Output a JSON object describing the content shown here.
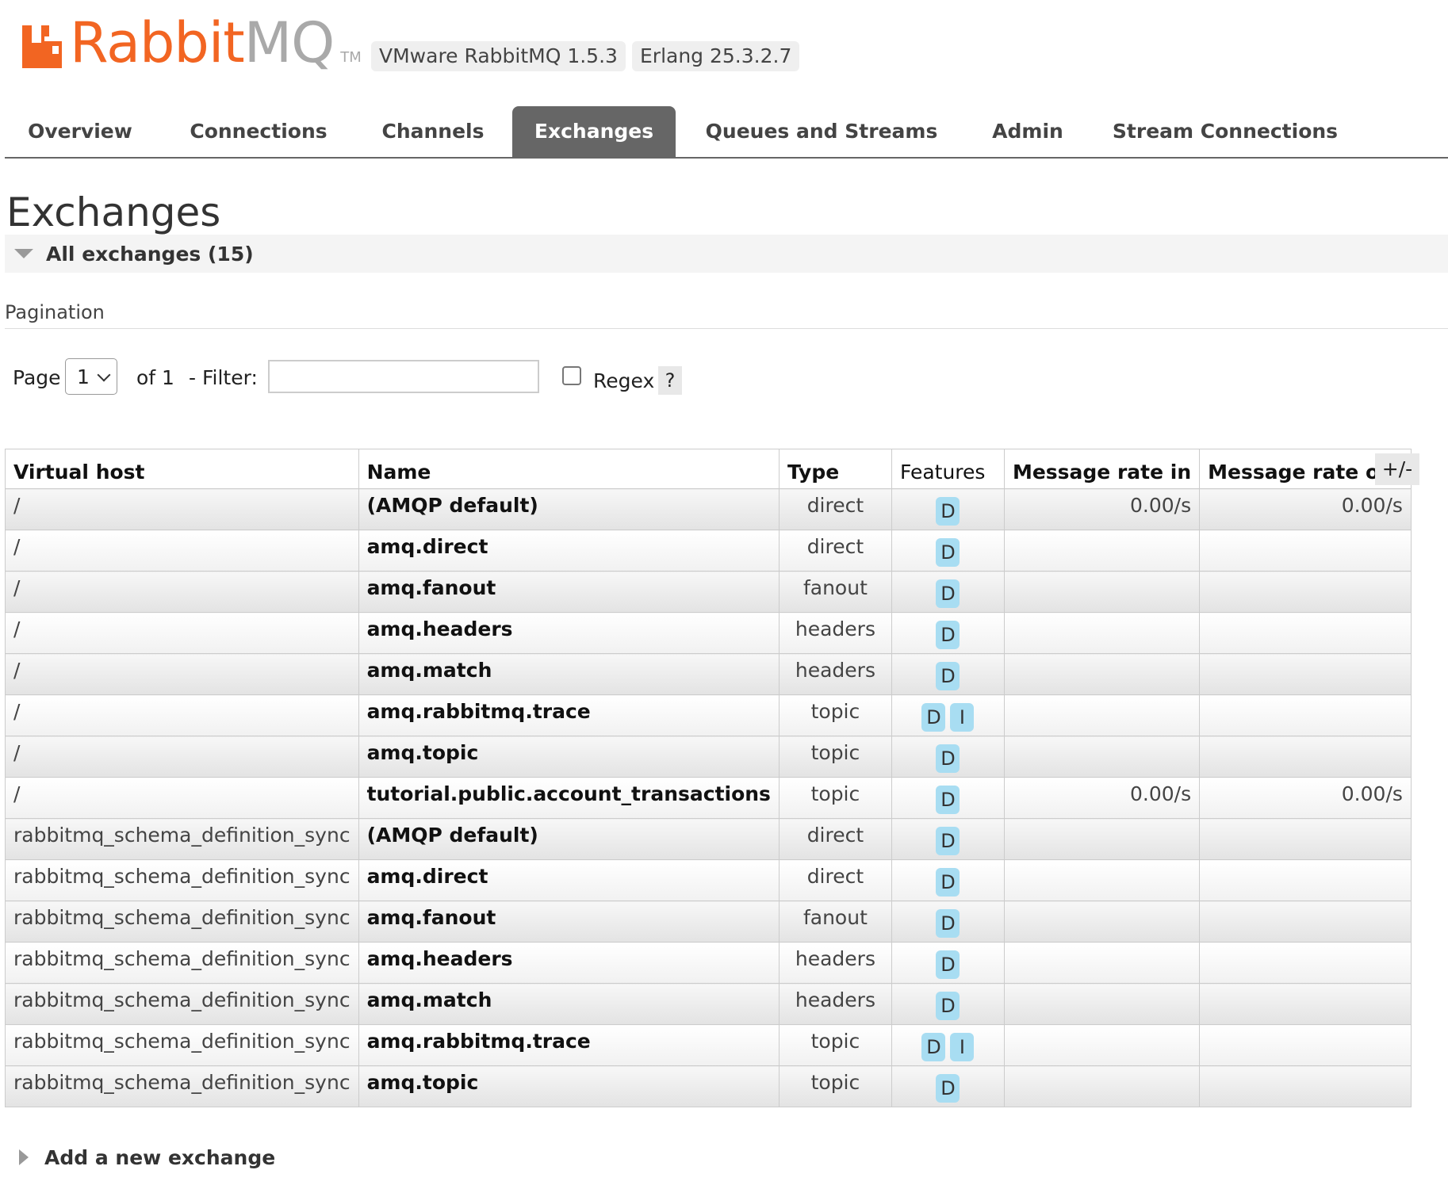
{
  "brand": {
    "name_part1": "Rabbit",
    "name_part2": "MQ",
    "tm": "TM",
    "primary_color": "#f26522",
    "secondary_color": "#a9a9a9"
  },
  "versions": {
    "product": "VMware RabbitMQ 1.5.3",
    "erlang": "Erlang 25.3.2.7"
  },
  "nav": {
    "tabs": [
      {
        "label": "Overview",
        "active": false
      },
      {
        "label": "Connections",
        "active": false
      },
      {
        "label": "Channels",
        "active": false
      },
      {
        "label": "Exchanges",
        "active": true
      },
      {
        "label": "Queues and Streams",
        "active": false
      },
      {
        "label": "Admin",
        "active": false
      },
      {
        "label": "Stream Connections",
        "active": false
      }
    ]
  },
  "page": {
    "title": "Exchanges",
    "section_label": "All exchanges (15)",
    "pagination_label": "Pagination"
  },
  "pagination": {
    "page_label": "Page",
    "page_value": "1",
    "of_label": "of 1",
    "filter_label": "- Filter:",
    "filter_value": "",
    "regex_label": "Regex",
    "regex_checked": false,
    "help_label": "?"
  },
  "table": {
    "columns": [
      "Virtual host",
      "Name",
      "Type",
      "Features",
      "Message rate in",
      "Message rate out"
    ],
    "toggle_label": "+/-",
    "rows": [
      {
        "vhost": "/",
        "name": "(AMQP default)",
        "type": "direct",
        "features": [
          "D"
        ],
        "rate_in": "0.00/s",
        "rate_out": "0.00/s"
      },
      {
        "vhost": "/",
        "name": "amq.direct",
        "type": "direct",
        "features": [
          "D"
        ],
        "rate_in": "",
        "rate_out": ""
      },
      {
        "vhost": "/",
        "name": "amq.fanout",
        "type": "fanout",
        "features": [
          "D"
        ],
        "rate_in": "",
        "rate_out": ""
      },
      {
        "vhost": "/",
        "name": "amq.headers",
        "type": "headers",
        "features": [
          "D"
        ],
        "rate_in": "",
        "rate_out": ""
      },
      {
        "vhost": "/",
        "name": "amq.match",
        "type": "headers",
        "features": [
          "D"
        ],
        "rate_in": "",
        "rate_out": ""
      },
      {
        "vhost": "/",
        "name": "amq.rabbitmq.trace",
        "type": "topic",
        "features": [
          "D",
          "I"
        ],
        "rate_in": "",
        "rate_out": ""
      },
      {
        "vhost": "/",
        "name": "amq.topic",
        "type": "topic",
        "features": [
          "D"
        ],
        "rate_in": "",
        "rate_out": ""
      },
      {
        "vhost": "/",
        "name": "tutorial.public.account_transactions",
        "type": "topic",
        "features": [
          "D"
        ],
        "rate_in": "0.00/s",
        "rate_out": "0.00/s"
      },
      {
        "vhost": "rabbitmq_schema_definition_sync",
        "name": "(AMQP default)",
        "type": "direct",
        "features": [
          "D"
        ],
        "rate_in": "",
        "rate_out": ""
      },
      {
        "vhost": "rabbitmq_schema_definition_sync",
        "name": "amq.direct",
        "type": "direct",
        "features": [
          "D"
        ],
        "rate_in": "",
        "rate_out": ""
      },
      {
        "vhost": "rabbitmq_schema_definition_sync",
        "name": "amq.fanout",
        "type": "fanout",
        "features": [
          "D"
        ],
        "rate_in": "",
        "rate_out": ""
      },
      {
        "vhost": "rabbitmq_schema_definition_sync",
        "name": "amq.headers",
        "type": "headers",
        "features": [
          "D"
        ],
        "rate_in": "",
        "rate_out": ""
      },
      {
        "vhost": "rabbitmq_schema_definition_sync",
        "name": "amq.match",
        "type": "headers",
        "features": [
          "D"
        ],
        "rate_in": "",
        "rate_out": ""
      },
      {
        "vhost": "rabbitmq_schema_definition_sync",
        "name": "amq.rabbitmq.trace",
        "type": "topic",
        "features": [
          "D",
          "I"
        ],
        "rate_in": "",
        "rate_out": ""
      },
      {
        "vhost": "rabbitmq_schema_definition_sync",
        "name": "amq.topic",
        "type": "topic",
        "features": [
          "D"
        ],
        "rate_in": "",
        "rate_out": ""
      }
    ]
  },
  "footer": {
    "add_exchange_label": "Add a new exchange"
  },
  "colors": {
    "nav_active_bg": "#666666",
    "feature_badge_bg": "#a8ddf2"
  }
}
